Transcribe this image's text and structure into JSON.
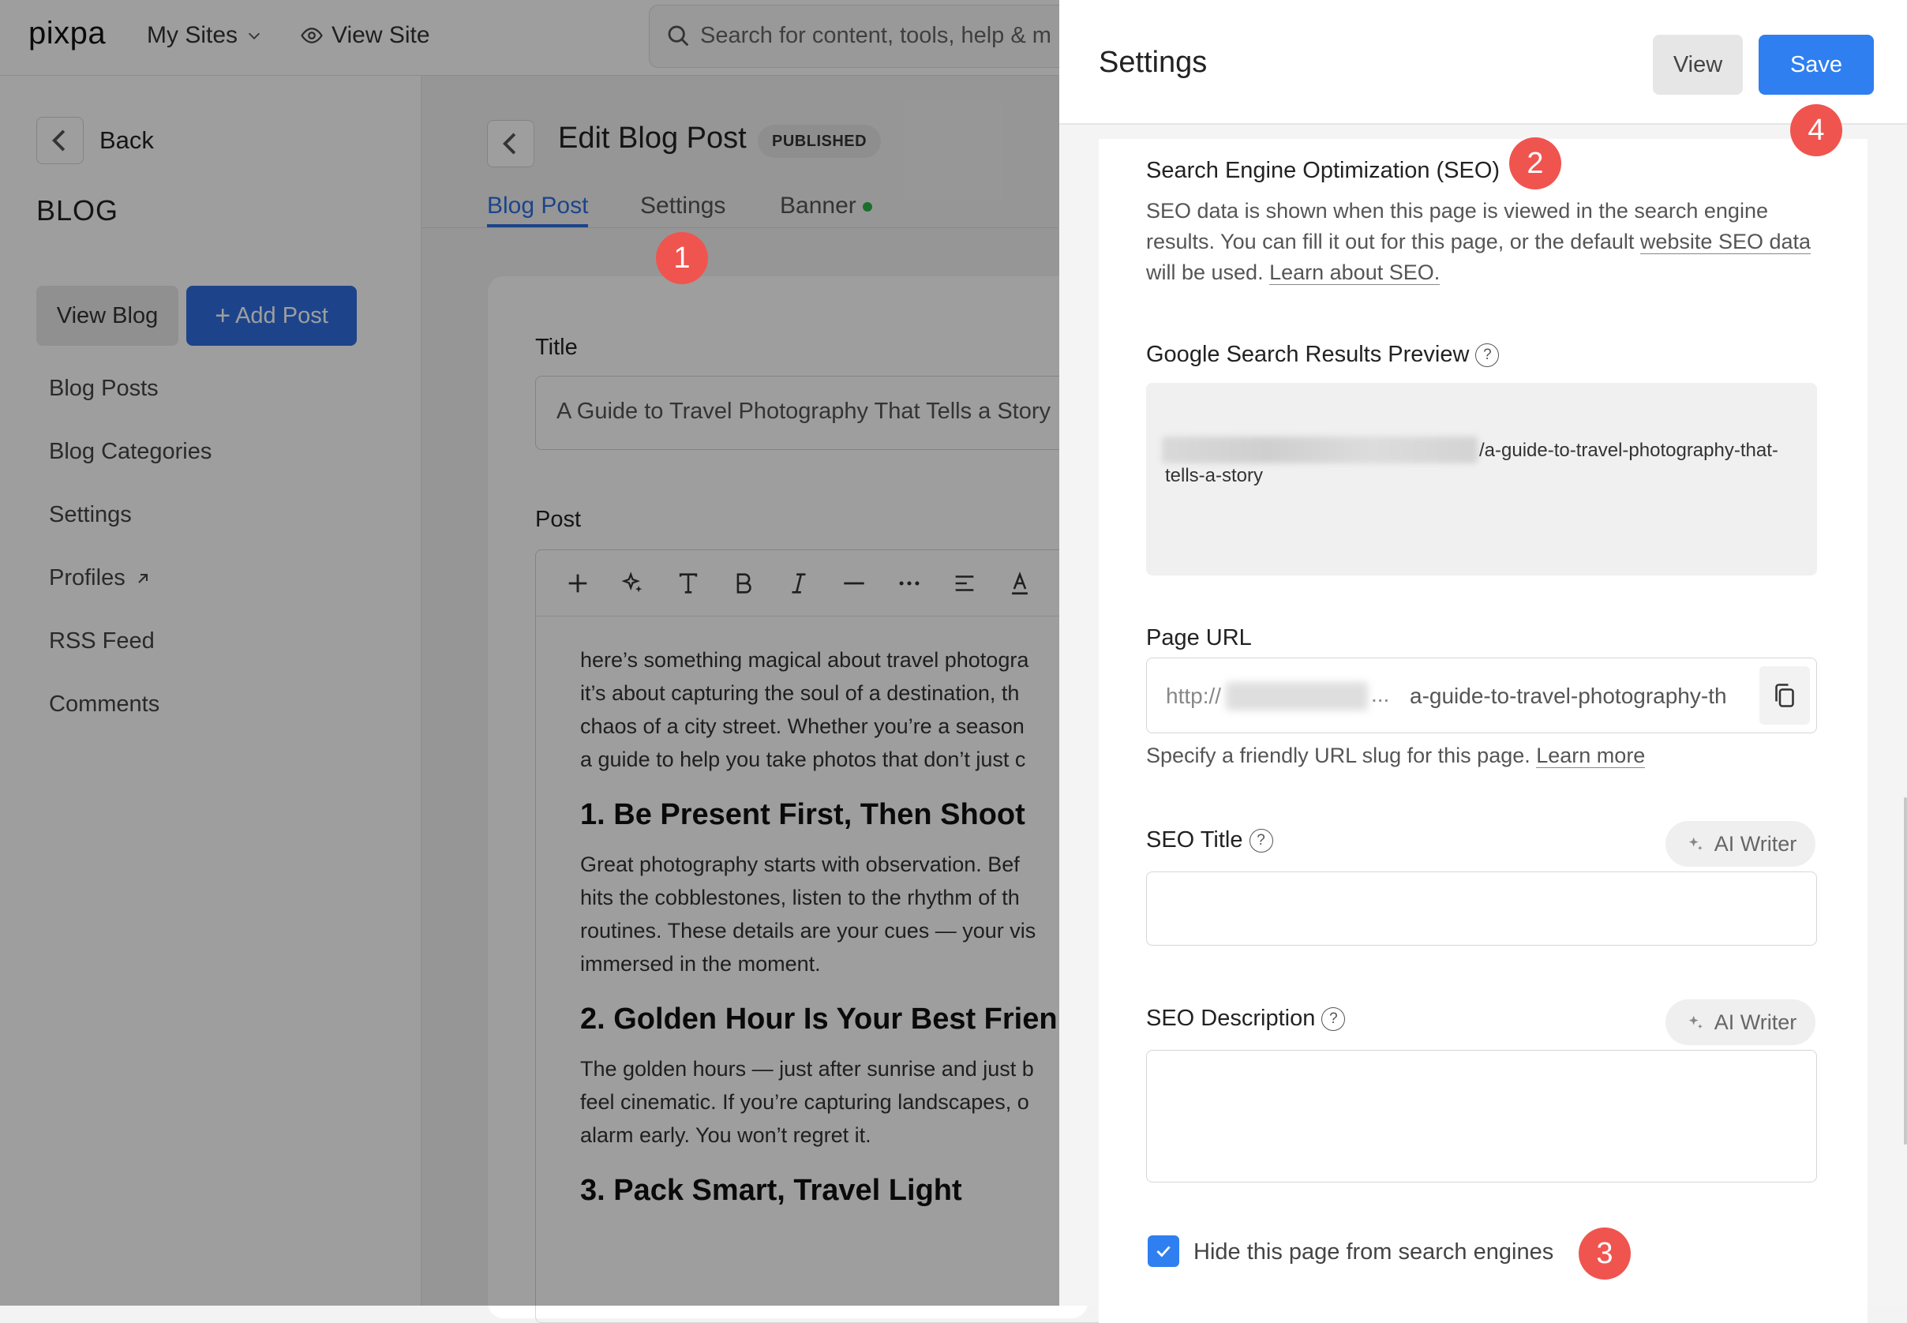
{
  "topbar": {
    "logo": "pixpa",
    "my_sites": "My Sites",
    "view_site": "View Site",
    "search_placeholder": "Search for content, tools, help & m"
  },
  "sidebar": {
    "back_label": "Back",
    "heading": "BLOG",
    "view_blog": "View Blog",
    "add_post": "Add Post",
    "items": [
      {
        "label": "Blog Posts"
      },
      {
        "label": "Blog Categories"
      },
      {
        "label": "Settings"
      },
      {
        "label": "Profiles"
      },
      {
        "label": "RSS Feed"
      },
      {
        "label": "Comments"
      }
    ]
  },
  "main": {
    "title": "Edit Blog Post",
    "badge": "PUBLISHED",
    "tabs": [
      {
        "label": "Blog Post",
        "active": true
      },
      {
        "label": "Settings",
        "active": false
      },
      {
        "label": "Banner",
        "active": false
      }
    ],
    "title_label": "Title",
    "title_value": "A Guide to Travel Photography That Tells a Story",
    "post_label": "Post",
    "post": {
      "p1": [
        "here’s something magical about travel photogra",
        "it’s about capturing the soul of a destination, th",
        "chaos of a city street. Whether you’re a season",
        "a guide to help you take photos that don’t just c"
      ],
      "h1": "1. Be Present First, Then Shoot",
      "p2": [
        "Great photography starts with observation. Bef",
        "hits the cobblestones, listen to the rhythm of th",
        "routines. These details are your cues — your vis",
        "immersed in the moment."
      ],
      "h2": "2. Golden Hour Is Your Best Frien",
      "p3": [
        "The golden hours — just after sunrise and just b",
        "feel cinematic. If you’re capturing landscapes, o",
        "alarm early. You won’t regret it."
      ],
      "h3": "3. Pack Smart, Travel Light"
    }
  },
  "settings_panel": {
    "title": "Settings",
    "view_button": "View",
    "save_button": "Save",
    "seo": {
      "title": "Search Engine Optimization (SEO)",
      "desc_1": "SEO data is shown when this page is viewed in the search engine results. You can fill it out for this page, or the default ",
      "desc_link_1": "website SEO data",
      "desc_2": " will be used. ",
      "desc_link_2": "Learn about SEO."
    },
    "preview": {
      "label": "Google Search Results Preview",
      "url_text": "/a-guide-to-travel-photography-that-tells-a-story"
    },
    "page_url": {
      "label": "Page URL",
      "protocol": "http://",
      "ellipsis": "...",
      "slug": "a-guide-to-travel-photography-th",
      "help": "Specify a friendly URL slug for this page. ",
      "help_link": "Learn more"
    },
    "seo_title": {
      "label": "SEO Title",
      "ai_writer": "AI Writer",
      "value": ""
    },
    "seo_description": {
      "label": "SEO Description",
      "ai_writer": "AI Writer",
      "value": ""
    },
    "hide_checkbox": {
      "label": "Hide this page from search engines",
      "checked": true
    }
  },
  "callouts": [
    "1",
    "2",
    "3",
    "4"
  ],
  "colors": {
    "accent": "#2f6fe0",
    "save": "#2f7ff0",
    "callout": "#f0544f",
    "banner_dot": "#2bb44a"
  }
}
